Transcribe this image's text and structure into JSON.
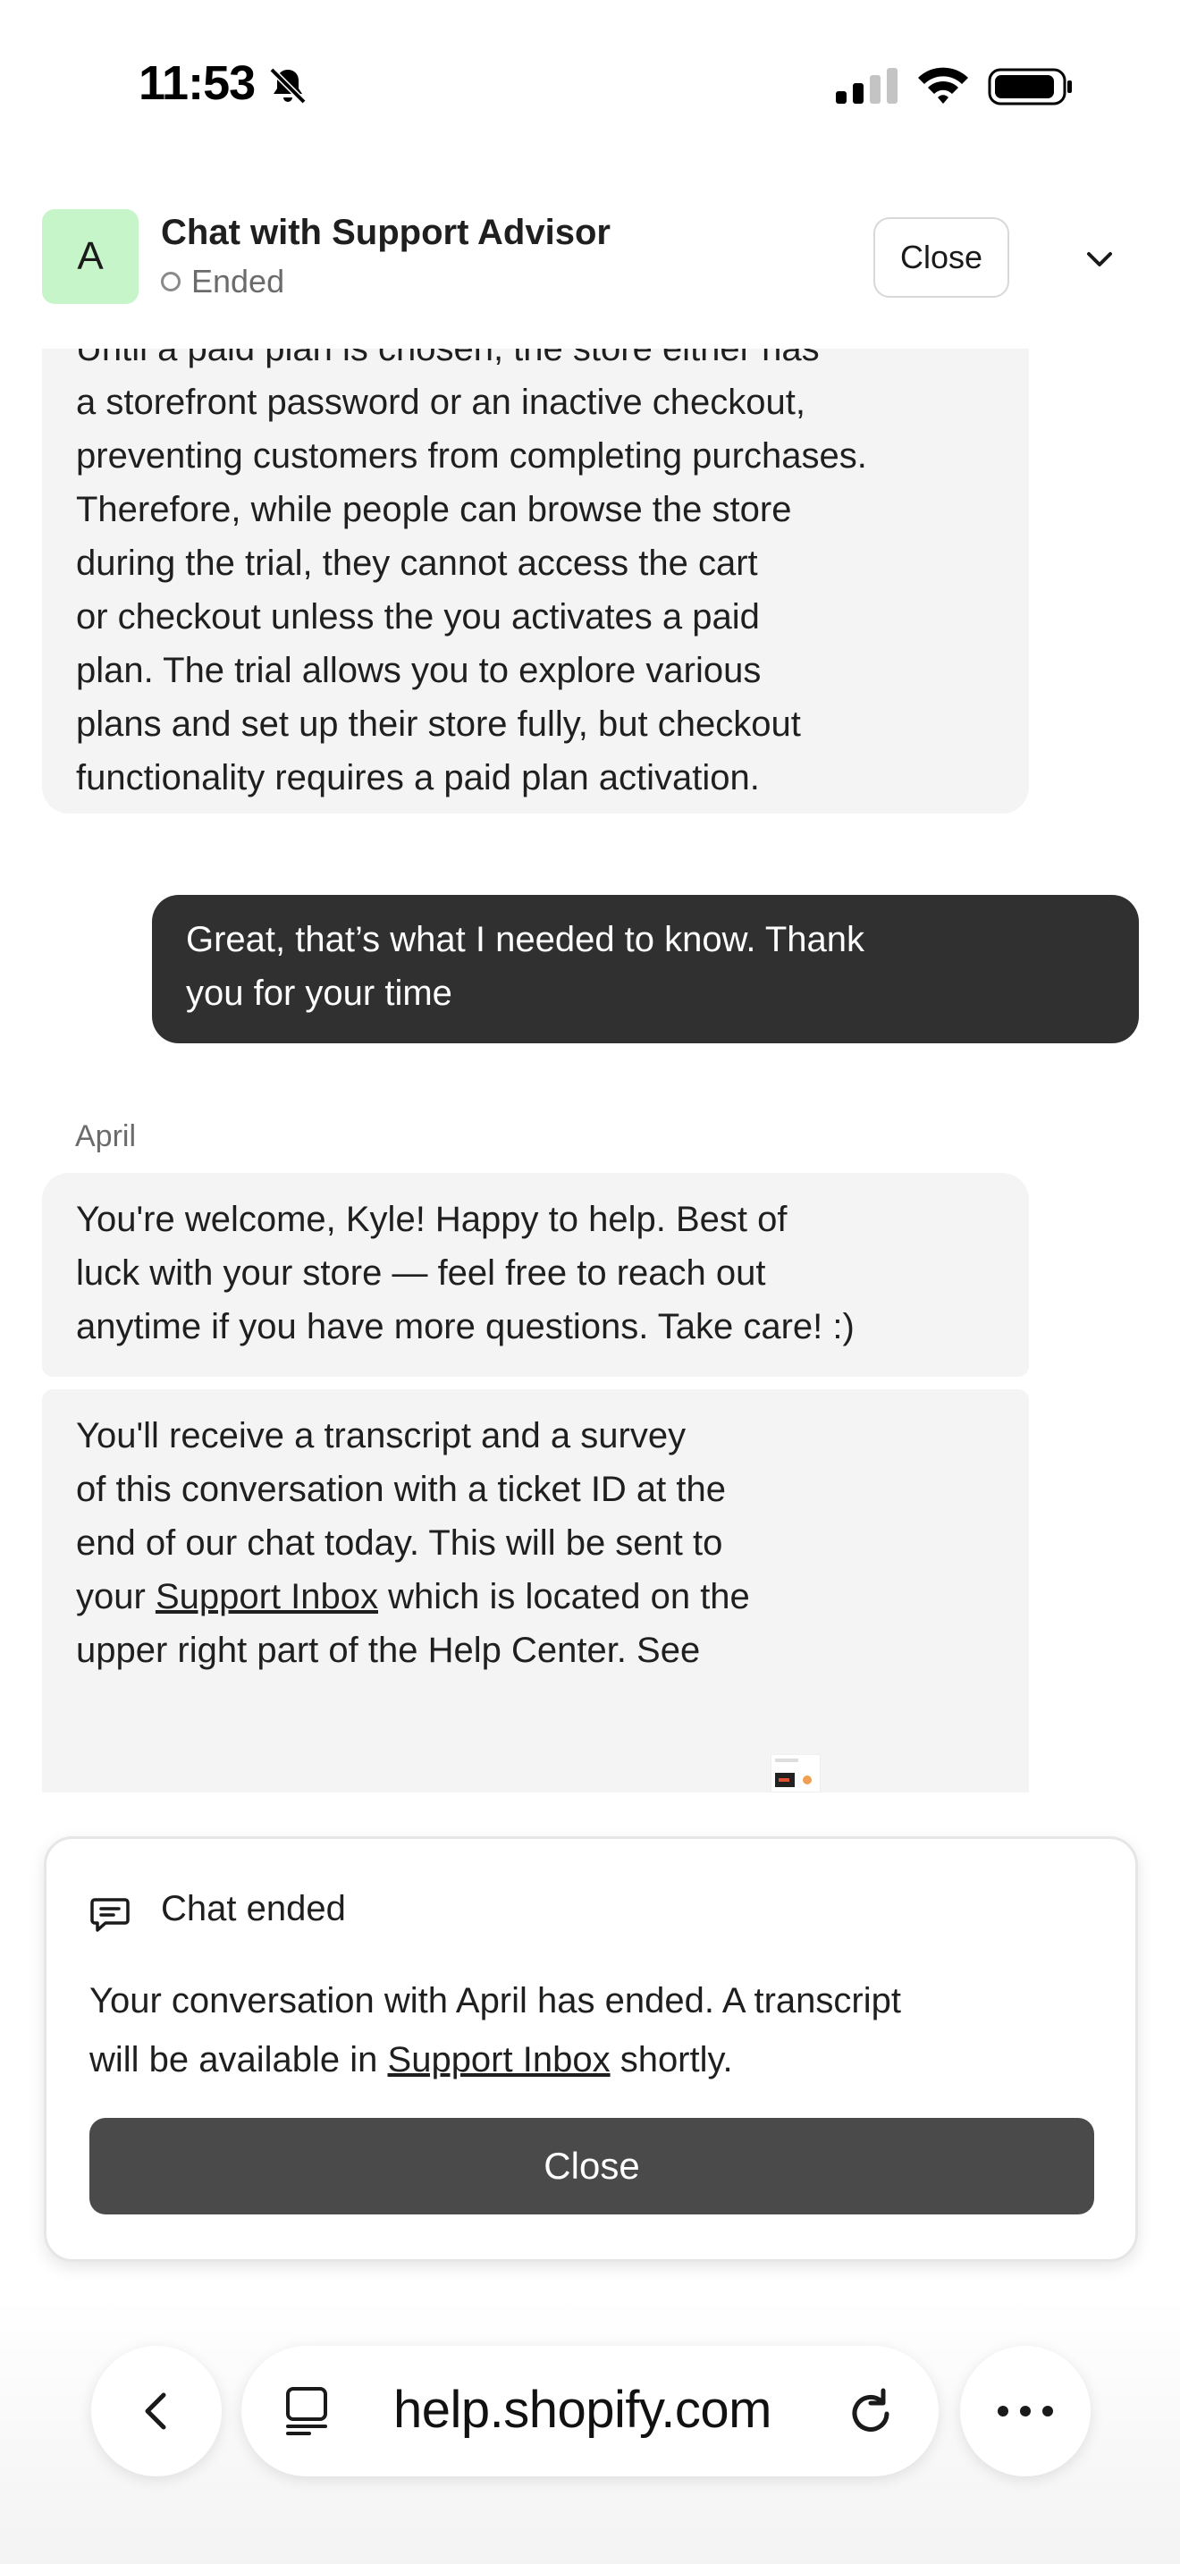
{
  "status_bar": {
    "time": "11:53"
  },
  "header": {
    "avatar_letter": "A",
    "title": "Chat with Support Advisor",
    "status": "Ended",
    "close_label": "Close"
  },
  "messages": {
    "first_bubble_lines": [
      "Until a paid plan is chosen, the store either has",
      "a storefront password or an inactive checkout,",
      "preventing customers from completing purchases.",
      "Therefore, while people can browse the store",
      "during the trial, they cannot access the cart",
      "or checkout unless the you activates a paid",
      "plan. The trial allows you to explore various",
      "plans and set up their store fully, but checkout",
      "functionality requires a paid plan activation."
    ],
    "user_lines": [
      "Great, that’s what I needed to know. Thank",
      "you for your time"
    ],
    "agent_name": "April",
    "welcome_lines": [
      "You're welcome, Kyle! Happy to help. Best of",
      "luck with your store — feel free to reach out",
      "anytime if you have more questions. Take care! :)"
    ],
    "transcript_lines": [
      "You'll receive a transcript and a survey",
      "of this conversation with a ticket ID at the",
      "end of our chat today. This will be sent to"
    ],
    "transcript_line4_prefix": "your ",
    "transcript_link": "Support Inbox",
    "transcript_line4_suffix": " which is located on the",
    "transcript_line5": "upper right part of the Help Center. See"
  },
  "ended_card": {
    "title": "Chat ended",
    "body_line1": "Your conversation with April has ended. A transcript",
    "body_line2_prefix": "will be available in ",
    "body_link": "Support Inbox",
    "body_line2_suffix": " shortly.",
    "close_label": "Close"
  },
  "browser": {
    "url": "help.shopify.com"
  },
  "icons": {
    "bell": "bell-slash-icon",
    "signal": "cellular-signal-icon",
    "wifi": "wifi-icon",
    "battery": "battery-icon",
    "chevron": "chevron-down-icon",
    "chat": "chat-bubble-icon",
    "back": "chevron-left-icon",
    "tabs": "tab-overview-icon",
    "reload": "reload-icon",
    "more": "ellipsis-icon"
  },
  "colors": {
    "avatar_bg": "#c6f5c9",
    "user_bubble": "#303030",
    "agent_bubble": "#f4f4f4",
    "primary_button": "#4a4a4a"
  }
}
